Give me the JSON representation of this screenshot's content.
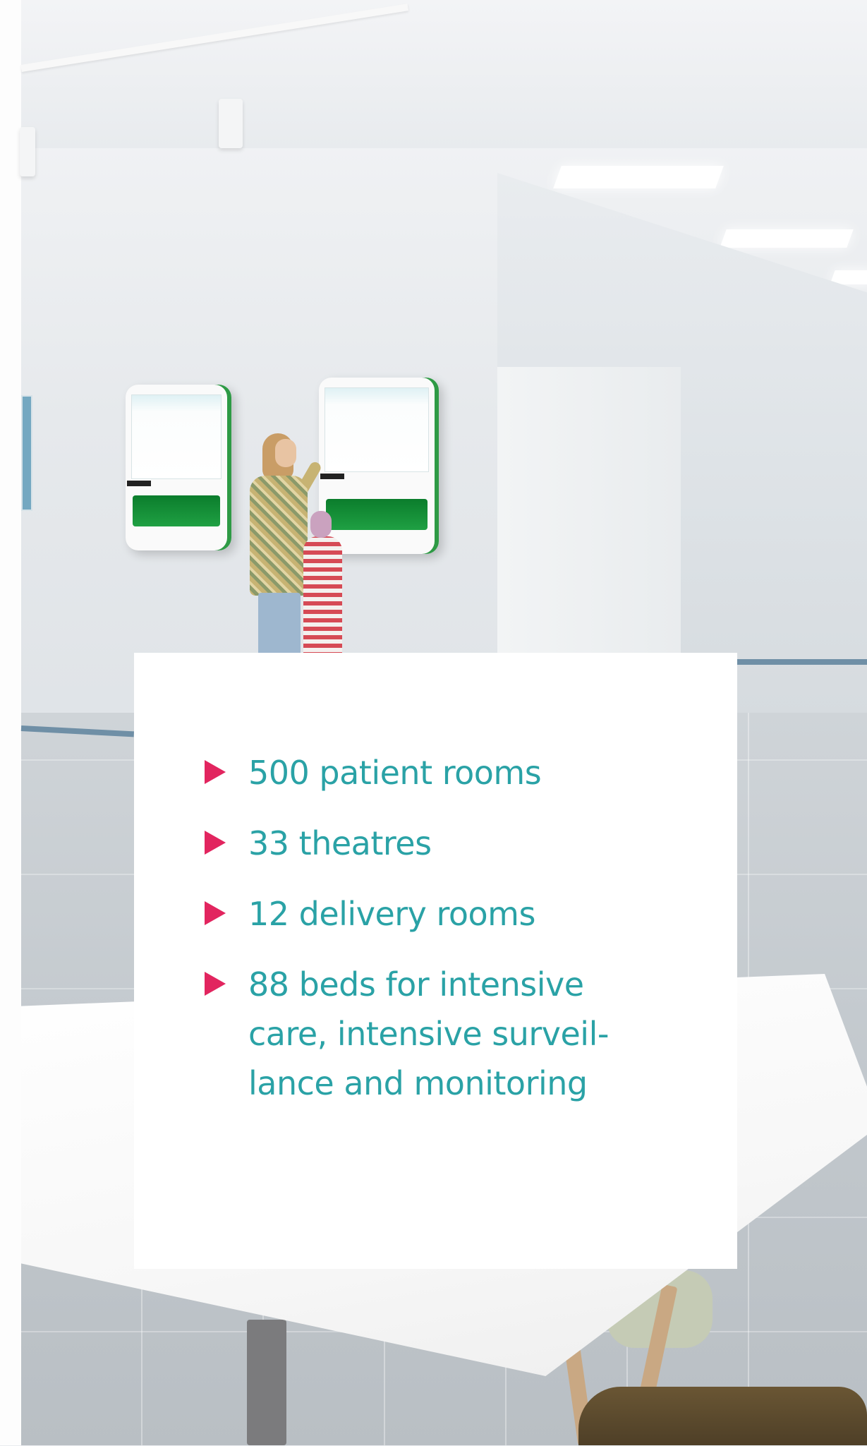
{
  "stats_panel": {
    "items": [
      {
        "text": "500 patient rooms"
      },
      {
        "text": "33 theatres"
      },
      {
        "text": "12 delivery rooms"
      },
      {
        "text": "88 beds for intensive care, intensive surveil- lance and monitoring"
      }
    ],
    "colors": {
      "text": "#2aa2a6",
      "bullet": "#e2255f",
      "card_background": "#ffffff"
    },
    "bullet_icon": "triangle-right-icon"
  },
  "background_photo": {
    "subject": "hospital-lobby-photo",
    "accent_color": "#1fa043"
  }
}
